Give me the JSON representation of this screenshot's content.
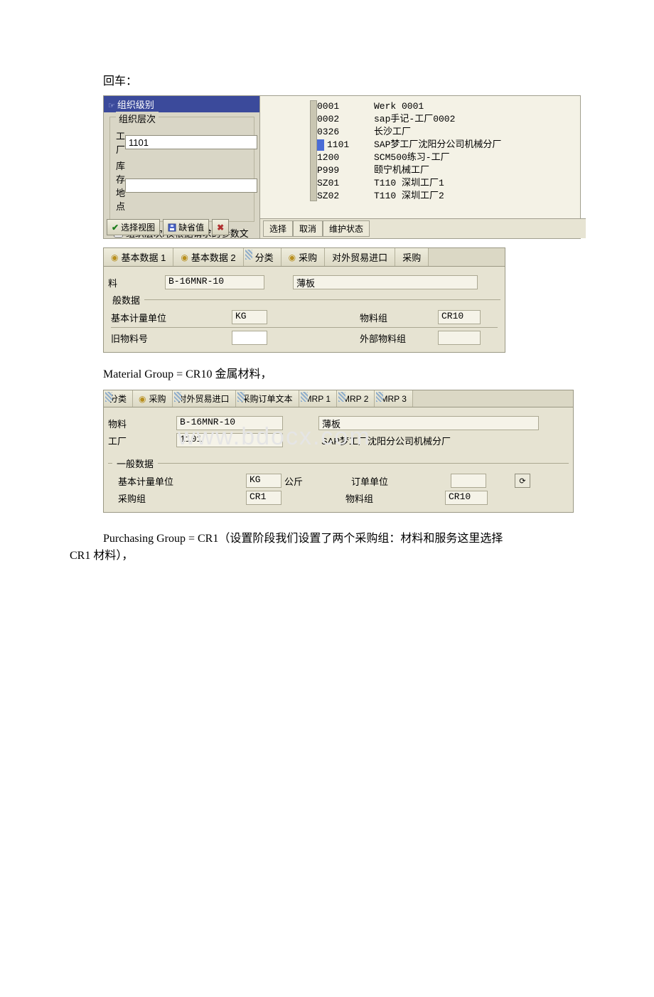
{
  "captions": {
    "enter": "回车：",
    "material_group": "Material Group = CR10 金属材料，",
    "purchasing_group_1": "Purchasing Group = CR1（设置阶段我们设置了两个采购组：材料和服务这里选择",
    "purchasing_group_2": "CR1 材料），"
  },
  "org_panel": {
    "title": "组织级别",
    "group_label": "组织层次",
    "plant_label": "工厂",
    "plant_value": "1101",
    "storage_label": "库存地点",
    "storage_value": "",
    "checkbox_label": "组织层次/仅根据请求的参数文",
    "btn_select_view": "选择视图",
    "btn_defaults": "缺省值"
  },
  "popup": {
    "items": [
      {
        "code": "0001",
        "desc": "Werk 0001"
      },
      {
        "code": "0002",
        "desc": "sap手记-工厂0002"
      },
      {
        "code": "0326",
        "desc": "长沙工厂"
      },
      {
        "code": "1101",
        "desc": "SAP梦工厂沈阳分公司机械分厂",
        "selected": true
      },
      {
        "code": "1200",
        "desc": "SCM500练习-工厂"
      },
      {
        "code": "P999",
        "desc": "颐宁机械工厂"
      },
      {
        "code": "SZ01",
        "desc": "T110 深圳工厂1"
      },
      {
        "code": "SZ02",
        "desc": "T110 深圳工厂2"
      }
    ],
    "footer": {
      "select": "选择",
      "cancel": "取消",
      "status": "维护状态"
    }
  },
  "shot2": {
    "tabs": [
      {
        "label": "基本数据 1",
        "eye": true
      },
      {
        "label": "基本数据 2",
        "eye": true
      },
      {
        "label": "分类",
        "hatch": true
      },
      {
        "label": "采购",
        "eye": true
      },
      {
        "label": "对外贸易进口"
      },
      {
        "label": "采购"
      }
    ],
    "material_label": "料",
    "material_value": "B-16MNR-10",
    "material_desc": "薄板",
    "group_label": "般数据",
    "uom_label": "基本计量单位",
    "uom_value": "KG",
    "matgrp_label": "物料组",
    "matgrp_value": "CR10",
    "oldmat_label": "旧物料号",
    "oldmat_value": "",
    "extmatgrp_label": "外部物料组",
    "extmatgrp_value": ""
  },
  "shot3": {
    "tabs": [
      {
        "label": "分类",
        "hatch": true
      },
      {
        "label": "采购",
        "eye": true
      },
      {
        "label": "对外贸易进口",
        "hatch": true
      },
      {
        "label": "采购订单文本",
        "hatch": true
      },
      {
        "label": "MRP 1",
        "hatch": true
      },
      {
        "label": "MRP 2",
        "hatch": true
      },
      {
        "label": "MRP 3",
        "hatch": true
      }
    ],
    "material_label": "物料",
    "material_value": "B-16MNR-10",
    "material_desc": "薄板",
    "plant_label": "工厂",
    "plant_value": "1101",
    "plant_desc": "SAP梦工厂沈阳分公司机械分厂",
    "group_label": "一般数据",
    "uom_label": "基本计量单位",
    "uom_value": "KG",
    "uom_desc": "公斤",
    "order_unit_label": "订单单位",
    "order_unit_value": "",
    "pgroup_label": "采购组",
    "pgroup_value": "CR1",
    "matgrp_label": "物料组",
    "matgrp_value": "CR10"
  },
  "watermark": "www.bdocx.com"
}
